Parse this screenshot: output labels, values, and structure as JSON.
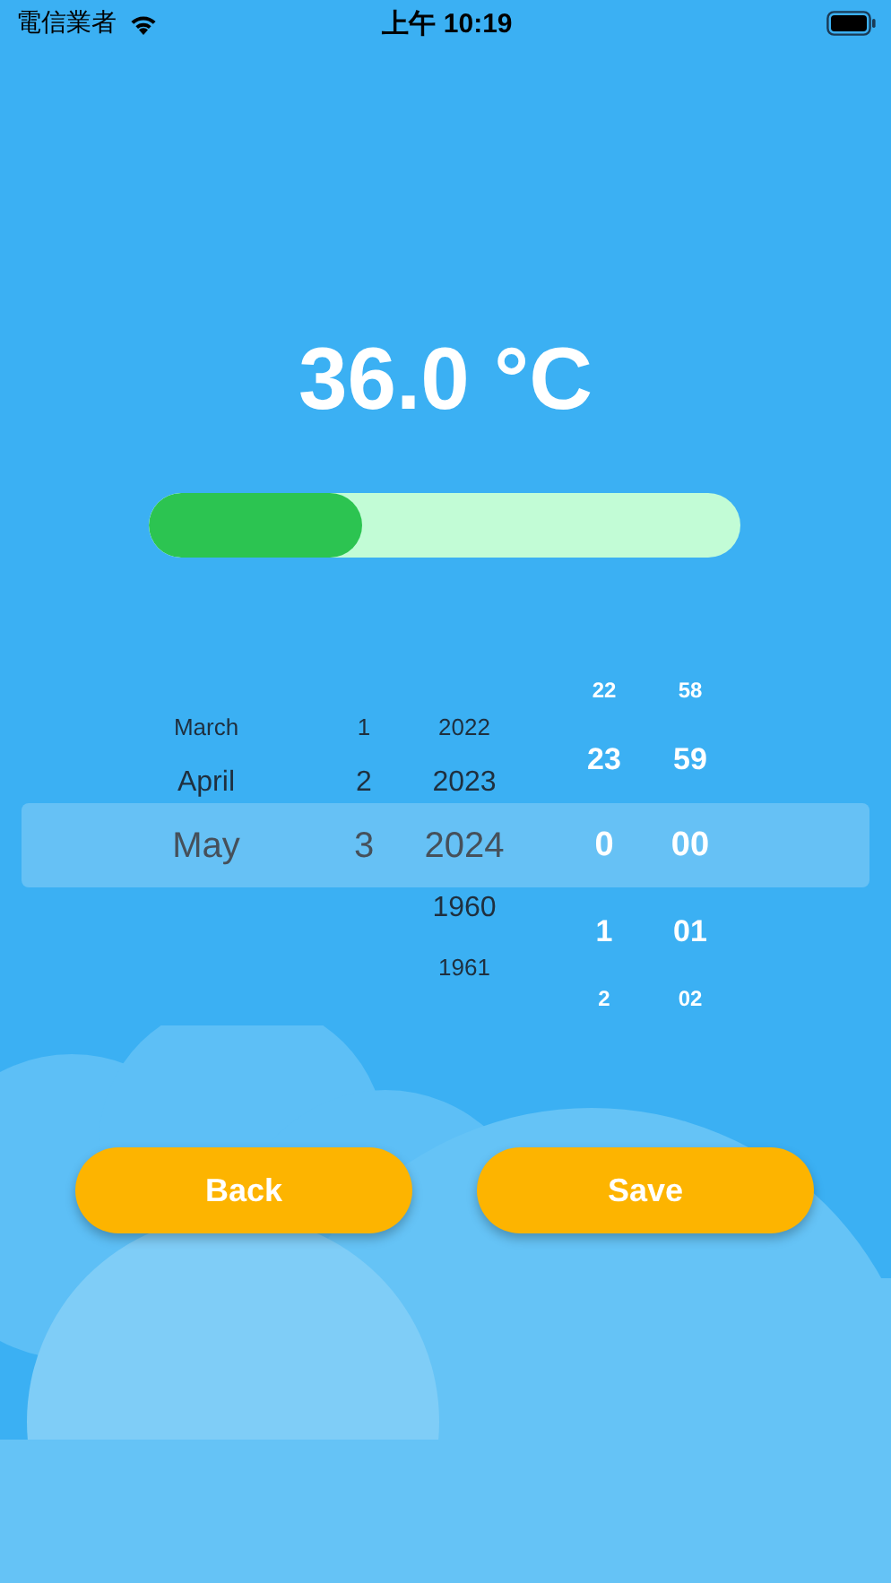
{
  "status_bar": {
    "carrier": "電信業者",
    "time": "上午 10:19"
  },
  "temperature": "36.0 °C",
  "progress": {
    "level": 0.36
  },
  "pickers": [
    {
      "kind": "date",
      "columns": [
        {
          "items": [
            {
              "label": "March",
              "selected": false
            },
            {
              "label": "April",
              "selected": false
            },
            {
              "label": "May",
              "selected": true
            }
          ]
        },
        {
          "items": [
            {
              "label": "1",
              "selected": false
            },
            {
              "label": "2",
              "selected": false
            },
            {
              "label": "3",
              "selected": true
            }
          ]
        },
        {
          "items": [
            {
              "label": "2022",
              "selected": false
            },
            {
              "label": "2023",
              "selected": false
            },
            {
              "label": "2024",
              "selected": true
            },
            {
              "label": "1960",
              "selected": false
            },
            {
              "label": "1961",
              "selected": false
            }
          ]
        }
      ]
    },
    {
      "kind": "time",
      "columns": [
        {
          "items": [
            {
              "label": "22",
              "selected": false
            },
            {
              "label": "23",
              "selected": false
            },
            {
              "label": "0",
              "selected": true
            },
            {
              "label": "1",
              "selected": false
            },
            {
              "label": "2",
              "selected": false
            }
          ]
        },
        {
          "items": [
            {
              "label": "58",
              "selected": false
            },
            {
              "label": "59",
              "selected": false
            },
            {
              "label": "00",
              "selected": true
            },
            {
              "label": "01",
              "selected": false
            },
            {
              "label": "02",
              "selected": false
            }
          ]
        }
      ]
    }
  ],
  "buttons": [
    "Back",
    "Save"
  ]
}
